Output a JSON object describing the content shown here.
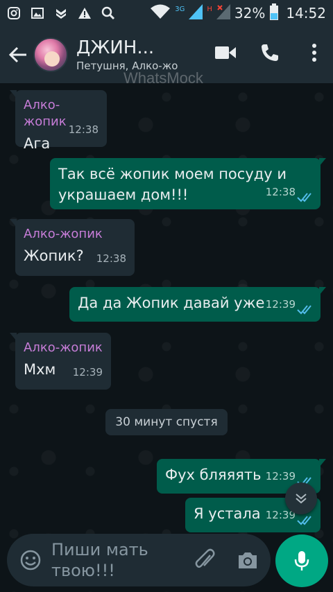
{
  "status_bar": {
    "network_3g": "3G",
    "network_h": "H",
    "battery_percent": "32%",
    "time": "14:52"
  },
  "header": {
    "title": "ДЖИН...",
    "subtitle": "Петушня, Алко-жо"
  },
  "watermark": "WhatsMock",
  "messages": [
    {
      "direction": "in",
      "sender": "Алко-жопик",
      "text": "Ага",
      "time": "12:38"
    },
    {
      "direction": "out",
      "text": "Так всё жопик моем посуду и украшаем дом!!!",
      "time": "12:38",
      "status": "read"
    },
    {
      "direction": "in",
      "sender": "Алко-жопик",
      "text": "Жопик?",
      "time": "12:38"
    },
    {
      "direction": "out",
      "text": "Да да Жопик давай уже",
      "time": "12:39",
      "status": "read"
    },
    {
      "direction": "in",
      "sender": "Алко-жопик",
      "text": "Мхм",
      "time": "12:39"
    },
    {
      "direction": "out",
      "text": "Фух бляяять",
      "time": "12:39",
      "status": "read"
    },
    {
      "direction": "out",
      "text": "Я устала",
      "time": "12:39",
      "status": "read"
    }
  ],
  "divider": "30 минут спустя",
  "input": {
    "placeholder": "Пиши мать твою!!!"
  },
  "colors": {
    "header_bg": "#1f2c34",
    "incoming_bubble": "#1f2c34",
    "outgoing_bubble": "#005c4b",
    "sender_name": "#c77dd8",
    "read_ticks": "#53bdeb",
    "accent": "#00a884"
  },
  "icons": [
    "instagram-icon",
    "gallery-icon",
    "shield-icon",
    "warning-icon",
    "search-icon",
    "wifi-icon",
    "signal-icon",
    "battery-icon",
    "back-arrow-icon",
    "video-call-icon",
    "phone-icon",
    "more-vert-icon",
    "emoji-icon",
    "attach-icon",
    "camera-icon",
    "mic-icon",
    "chevron-down-icon",
    "double-check-icon"
  ]
}
